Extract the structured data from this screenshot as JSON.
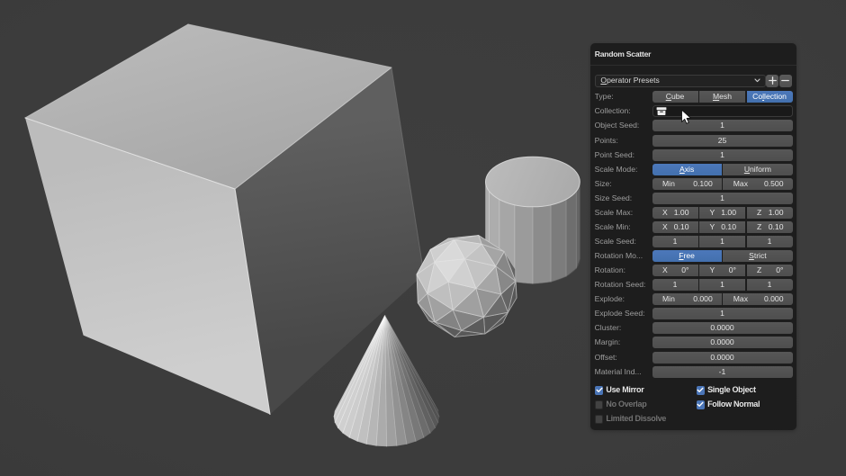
{
  "viewport": {
    "background_color": "#3c3c3c",
    "objects": [
      "cube",
      "cylinder",
      "icosphere",
      "cone"
    ],
    "object_base_color": "#a0a0a0",
    "cursor_icon": "arrow-cursor"
  },
  "panel": {
    "title": "Random Scatter",
    "colors": {
      "panel_bg": "#1d1d1d",
      "accent_blue": "#4b76b8",
      "field_gray": "#535353",
      "label_text": "#9d9d9d",
      "value_text": "#e5e5e5"
    },
    "presets": {
      "label": "Operator Presets",
      "underline_index": 0,
      "chevron_icon": "chevron-down-icon",
      "add_label": "+",
      "remove_label": "−"
    },
    "rows": [
      {
        "label": "Type:",
        "widget": {
          "kind": "enum",
          "items": [
            {
              "label": "Cube",
              "underline_index": 0,
              "selected": false
            },
            {
              "label": "Mesh",
              "underline_index": 0,
              "selected": false
            },
            {
              "label": "Collection",
              "underline_index": 2,
              "selected": true
            }
          ]
        }
      },
      {
        "label": "Collection:",
        "widget": {
          "kind": "pointer",
          "icon": "collection-icon",
          "value": ""
        }
      },
      {
        "label": "Object Seed:",
        "widget": {
          "kind": "value",
          "text": "1"
        }
      },
      {
        "label": "Points:",
        "widget": {
          "kind": "value",
          "text": "25"
        }
      },
      {
        "label": "Point Seed:",
        "widget": {
          "kind": "value",
          "text": "1"
        }
      },
      {
        "label": "Scale Mode:",
        "widget": {
          "kind": "enum",
          "items": [
            {
              "label": "Axis",
              "underline_index": 0,
              "selected": true
            },
            {
              "label": "Uniform",
              "underline_index": 0,
              "selected": false
            }
          ]
        }
      },
      {
        "label": "Size:",
        "widget": {
          "kind": "pairs",
          "segs": [
            {
              "label": "Min",
              "value": "0.100"
            },
            {
              "label": "Max",
              "value": "0.500"
            }
          ]
        }
      },
      {
        "label": "Size Seed:",
        "widget": {
          "kind": "value",
          "text": "1"
        }
      },
      {
        "label": "Scale Max:",
        "widget": {
          "kind": "pairs",
          "segs": [
            {
              "label": "X",
              "value": "1.00"
            },
            {
              "label": "Y",
              "value": "1.00"
            },
            {
              "label": "Z",
              "value": "1.00"
            }
          ]
        }
      },
      {
        "label": "Scale Min:",
        "widget": {
          "kind": "pairs",
          "segs": [
            {
              "label": "X",
              "value": "0.10"
            },
            {
              "label": "Y",
              "value": "0.10"
            },
            {
              "label": "Z",
              "value": "0.10"
            }
          ]
        }
      },
      {
        "label": "Scale Seed:",
        "widget": {
          "kind": "pairs",
          "segs": [
            {
              "value": "1"
            },
            {
              "value": "1"
            },
            {
              "value": "1"
            }
          ]
        }
      },
      {
        "label": "Rotation Mo...",
        "widget": {
          "kind": "enum",
          "items": [
            {
              "label": "Free",
              "underline_index": 0,
              "selected": true
            },
            {
              "label": "Strict",
              "underline_index": 0,
              "selected": false
            }
          ]
        }
      },
      {
        "label": "Rotation:",
        "widget": {
          "kind": "pairs",
          "segs": [
            {
              "label": "X",
              "value": "0°"
            },
            {
              "label": "Y",
              "value": "0°"
            },
            {
              "label": "Z",
              "value": "0°"
            }
          ]
        }
      },
      {
        "label": "Rotation Seed:",
        "widget": {
          "kind": "pairs",
          "segs": [
            {
              "value": "1"
            },
            {
              "value": "1"
            },
            {
              "value": "1"
            }
          ]
        }
      },
      {
        "label": "Explode:",
        "widget": {
          "kind": "pairs",
          "segs": [
            {
              "label": "Min",
              "value": "0.000"
            },
            {
              "label": "Max",
              "value": "0.000"
            }
          ]
        }
      },
      {
        "label": "Explode Seed:",
        "widget": {
          "kind": "value",
          "text": "1"
        }
      },
      {
        "label": "Cluster:",
        "widget": {
          "kind": "value",
          "text": "0.0000"
        }
      },
      {
        "label": "Margin:",
        "widget": {
          "kind": "value",
          "text": "0.0000"
        }
      },
      {
        "label": "Offset:",
        "widget": {
          "kind": "value",
          "text": "0.0000"
        }
      },
      {
        "label": "Material Ind...",
        "widget": {
          "kind": "value",
          "text": "-1"
        }
      }
    ],
    "checkboxes": [
      {
        "label": "Use Mirror",
        "checked": true,
        "disabled": false,
        "col": 0,
        "row": 0
      },
      {
        "label": "Single Object",
        "checked": true,
        "disabled": false,
        "col": 1,
        "row": 0
      },
      {
        "label": "No Overlap",
        "checked": false,
        "disabled": true,
        "col": 0,
        "row": 1
      },
      {
        "label": "Follow Normal",
        "checked": true,
        "disabled": false,
        "col": 1,
        "row": 1
      },
      {
        "label": "Limited Dissolve",
        "checked": false,
        "disabled": true,
        "col": 0,
        "row": 2
      }
    ]
  }
}
